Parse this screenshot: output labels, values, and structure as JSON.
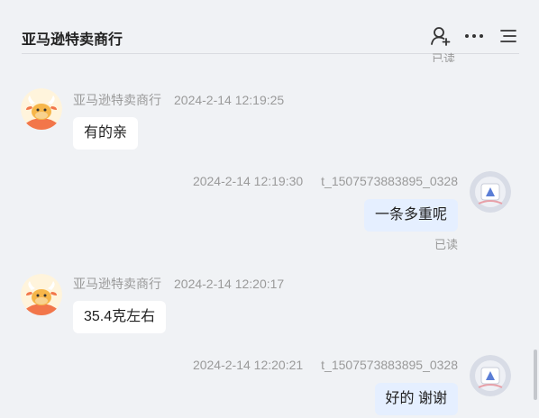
{
  "header": {
    "title": "亚马逊特卖商行",
    "icons": [
      "add-person-icon",
      "more-icon",
      "menu-icon"
    ]
  },
  "top_status": "已读",
  "messages": [
    {
      "side": "left",
      "name": "亚马逊特卖商行",
      "time": "2024-2-14 12:19:25",
      "text": "有的亲"
    },
    {
      "side": "right",
      "name": "t_1507573883895_0328",
      "time": "2024-2-14 12:19:30",
      "text": "一条多重呢",
      "status": "已读"
    },
    {
      "side": "left",
      "name": "亚马逊特卖商行",
      "time": "2024-2-14 12:20:17",
      "text": "35.4克左右"
    },
    {
      "side": "right",
      "name": "t_1507573883895_0328",
      "time": "2024-2-14 12:20:21",
      "text": "好的 谢谢"
    }
  ],
  "colors": {
    "background": "#f0f2f5",
    "self_bubble": "#e5efff",
    "other_bubble": "#ffffff",
    "meta_text": "#9a9a9a"
  }
}
